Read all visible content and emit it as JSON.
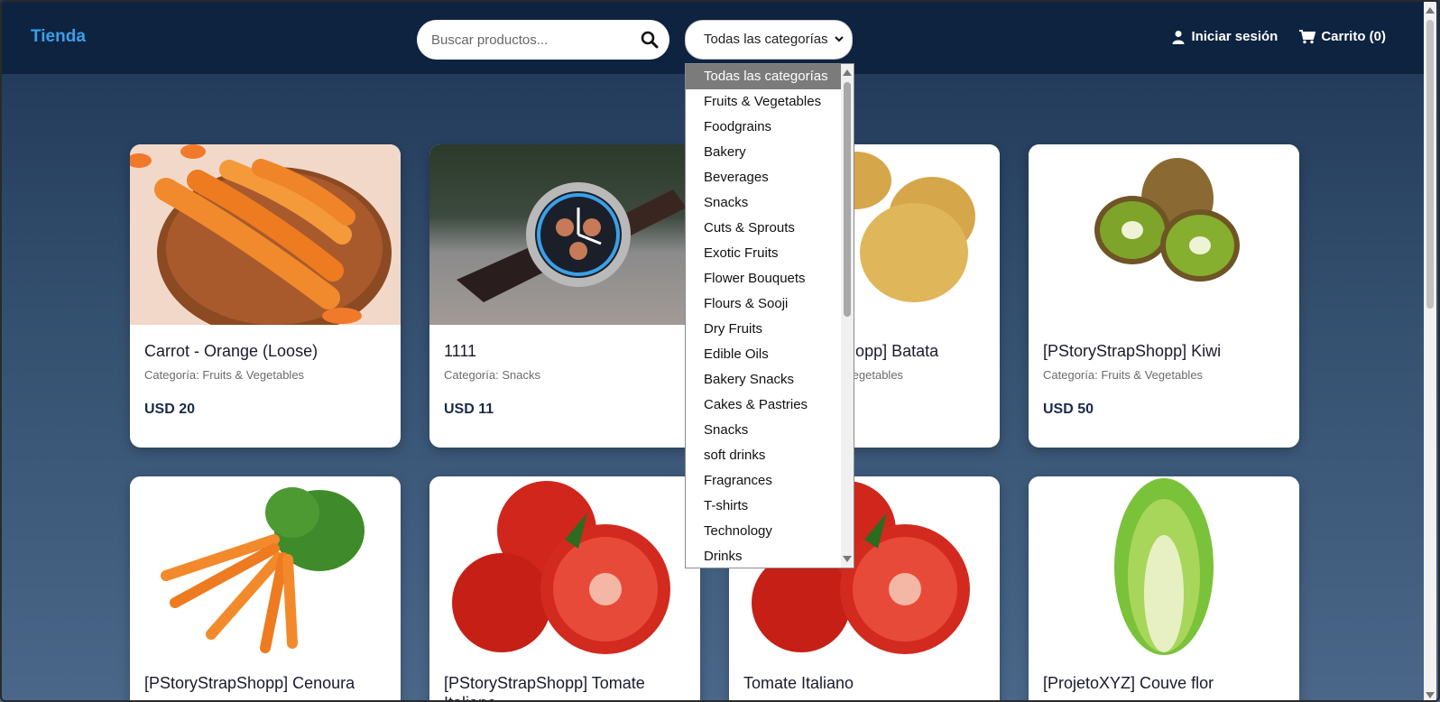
{
  "header": {
    "brand": "Tienda",
    "search_placeholder": "Buscar productos...",
    "category_selected": "Todas las categorías",
    "login_label": "Iniciar sesión",
    "cart_label": "Carrito (0)"
  },
  "dropdown": {
    "options": [
      "Todas las categorías",
      "Fruits & Vegetables",
      "Foodgrains",
      "Bakery",
      "Beverages",
      "Snacks",
      "Cuts & Sprouts",
      "Exotic Fruits",
      "Flower Bouquets",
      "Flours & Sooji",
      "Dry Fruits",
      "Edible Oils",
      "Bakery Snacks",
      "Cakes & Pastries",
      "Snacks",
      "soft drinks",
      "Fragrances",
      "T-shirts",
      "Technology",
      "Drinks"
    ]
  },
  "products": [
    {
      "title": "Carrot - Orange (Loose)",
      "category": "Categoría: Fruits & Vegetables",
      "price": "USD 20",
      "image": "carrots-on-board"
    },
    {
      "title": "1111",
      "category": "Categoría: Snacks",
      "price": "USD 11",
      "image": "wristwatch"
    },
    {
      "title": "[PStoryStrapShopp] Batata",
      "category": "Categoría: Fruits & Vegetables",
      "price": "",
      "image": "potatoes"
    },
    {
      "title": "[PStoryStrapShopp] Kiwi",
      "category": "Categoría: Fruits & Vegetables",
      "price": "USD 50",
      "image": "kiwis"
    },
    {
      "title": "[PStoryStrapShopp] Cenoura",
      "category": "",
      "price": "",
      "image": "carrot-bunch"
    },
    {
      "title": "[PStoryStrapShopp] Tomate Italiano",
      "category": "",
      "price": "",
      "image": "tomatoes"
    },
    {
      "title": "Tomate Italiano",
      "category": "",
      "price": "",
      "image": "tomatoes"
    },
    {
      "title": "[ProjetoXYZ] Couve flor",
      "category": "",
      "price": "",
      "image": "cabbage"
    }
  ]
}
